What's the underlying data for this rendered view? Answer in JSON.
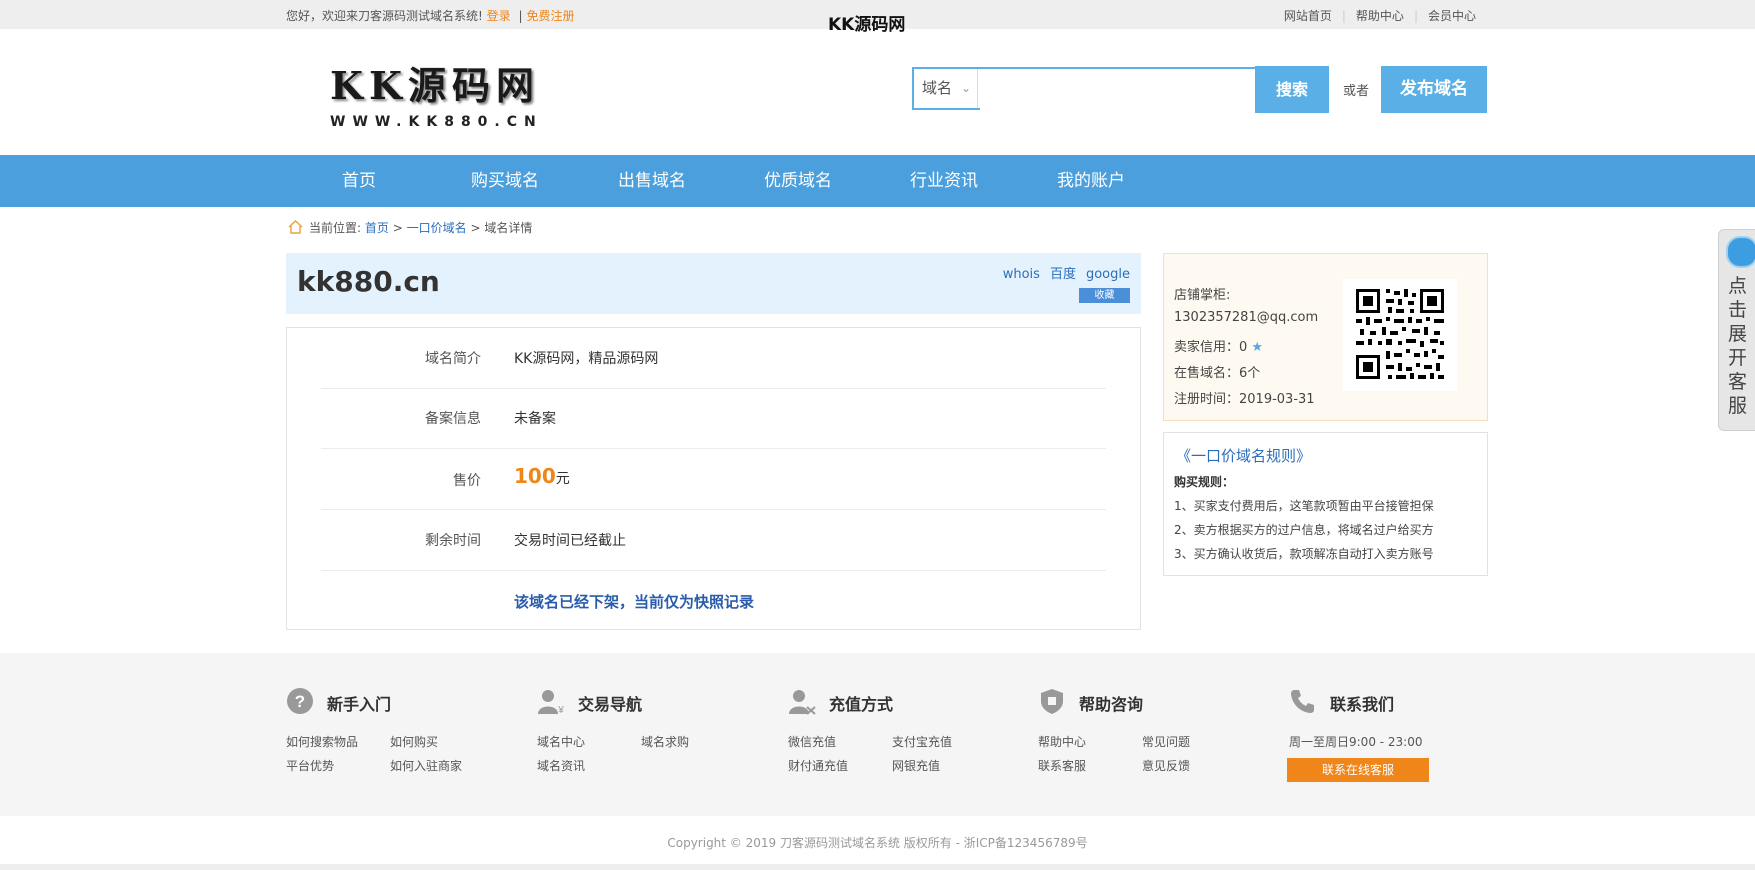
{
  "topbar": {
    "welcome": "您好，欢迎来刀客源码测试域名系统!",
    "login": "登录",
    "sep": "|",
    "register": "免费注册",
    "center_title": "KK源码网",
    "links": [
      "网站首页",
      "帮助中心",
      "会员中心"
    ]
  },
  "logo": {
    "big": "KK源码网",
    "small": "WWW.KK880.CN"
  },
  "search": {
    "select": "域名",
    "placeholder": "",
    "button": "搜索",
    "or": "或者",
    "publish": "发布域名"
  },
  "nav": [
    "首页",
    "购买域名",
    "出售域名",
    "优质域名",
    "行业资讯",
    "我的账户"
  ],
  "breadcrumb": {
    "label": "当前位置:",
    "home": "首页",
    "sep1": ">",
    "cat": "一口价域名",
    "sep2": ">",
    "current": "域名详情"
  },
  "domain": {
    "name": "kk880.cn",
    "whois": "whois",
    "baidu": "百度",
    "google": "google",
    "fav": "收藏"
  },
  "details": {
    "intro_label": "域名简介",
    "intro": "KK源码网，精品源码网",
    "icp_label": "备案信息",
    "icp": "未备案",
    "price_label": "售价",
    "price": "100",
    "price_unit": "元",
    "time_label": "剩余时间",
    "time": "交易时间已经截止",
    "notice": "该域名已经下架，当前仅为快照记录"
  },
  "shop": {
    "owner_label": "店铺掌柜:",
    "owner": "1302357281@qq.com",
    "credit": "卖家信用：0",
    "count": "在售域名：6个",
    "reg_time": "注册时间：2019-03-31"
  },
  "rules": {
    "title": "《一口价域名规则》",
    "head": "购买规则：",
    "items": [
      "1、买家支付费用后，这笔款项暂由平台接管担保",
      "2、卖方根据买方的过户信息，将域名过户给买方",
      "3、买方确认收货后，款项解冻自动打入卖方账号"
    ]
  },
  "side": {
    "text": "点击展开客服"
  },
  "footer": {
    "cols": [
      {
        "title": "新手入门",
        "icon": "question-icon",
        "links": [
          "如何搜索物品",
          "如何购买",
          "平台优势",
          "如何入驻商家"
        ]
      },
      {
        "title": "交易导航",
        "icon": "user-yen-icon",
        "links": [
          "域名中心",
          "域名求购",
          "域名资讯"
        ]
      },
      {
        "title": "充值方式",
        "icon": "user-card-icon",
        "links": [
          "微信充值",
          "支付宝充值",
          "财付通充值",
          "网银充值"
        ]
      },
      {
        "title": "帮助咨询",
        "icon": "shield-icon",
        "links": [
          "帮助中心",
          "常见问题",
          "联系客服",
          "意见反馈"
        ]
      },
      {
        "title": "联系我们",
        "icon": "phone-icon",
        "hours": "周一至周日9:00 - 23:00",
        "button": "联系在线客服"
      }
    ],
    "copyright": "Copyright © 2019 刀客源码测试域名系统 版权所有 - 浙ICP备123456789号"
  },
  "colors": {
    "accent": "#4b9fdd",
    "orange": "#f08519",
    "link": "#2a6ebd"
  }
}
